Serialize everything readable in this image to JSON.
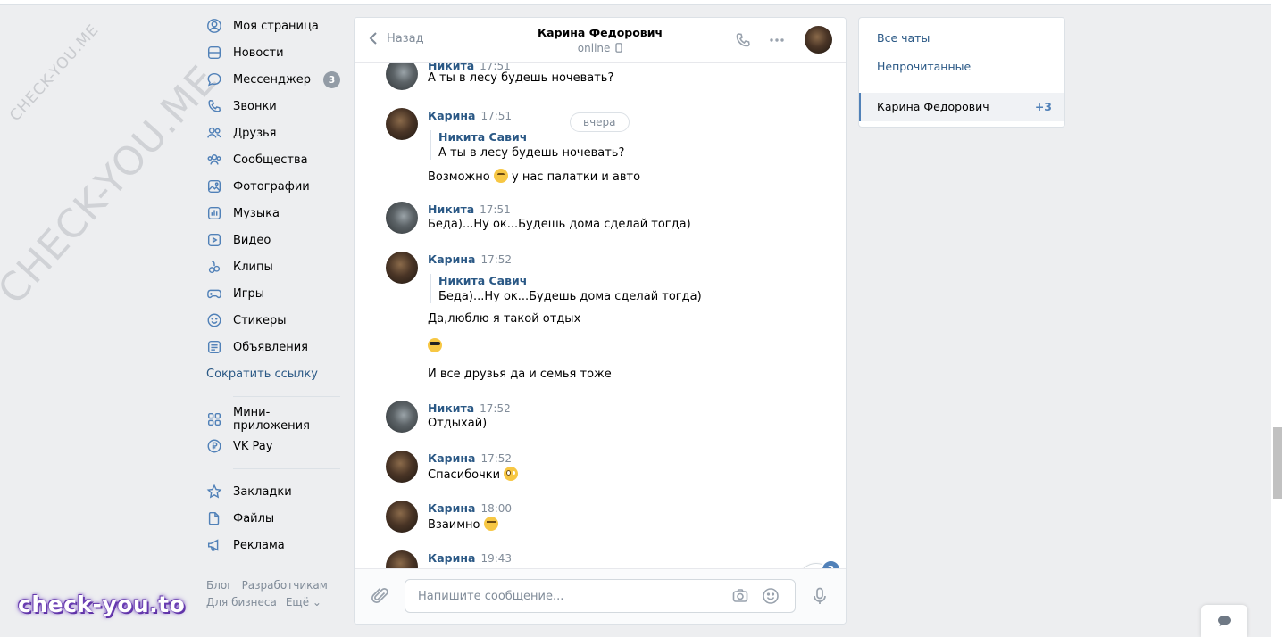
{
  "watermark": {
    "text": "CHECK-YOU.ME"
  },
  "logo": {
    "text": "check-you.to"
  },
  "nav": {
    "items": [
      {
        "label": "Моя страница",
        "icon": "user-circle-icon"
      },
      {
        "label": "Новости",
        "icon": "news-icon"
      },
      {
        "label": "Мессенджер",
        "icon": "chat-bubble-icon",
        "badge": "3"
      },
      {
        "label": "Звонки",
        "icon": "phone-icon"
      },
      {
        "label": "Друзья",
        "icon": "friends-icon"
      },
      {
        "label": "Сообщества",
        "icon": "communities-icon"
      },
      {
        "label": "Фотографии",
        "icon": "photo-icon"
      },
      {
        "label": "Музыка",
        "icon": "music-icon"
      },
      {
        "label": "Видео",
        "icon": "video-icon"
      },
      {
        "label": "Клипы",
        "icon": "clips-icon"
      },
      {
        "label": "Игры",
        "icon": "gamepad-icon"
      },
      {
        "label": "Стикеры",
        "icon": "smile-icon"
      },
      {
        "label": "Объявления",
        "icon": "classifieds-icon"
      }
    ],
    "shorten_link": "Сократить ссылку",
    "apps": [
      {
        "label": "Мини-приложения",
        "icon": "grid-icon"
      },
      {
        "label": "VK Pay",
        "icon": "ruble-icon"
      }
    ],
    "misc": [
      {
        "label": "Закладки",
        "icon": "star-icon"
      },
      {
        "label": "Файлы",
        "icon": "file-icon"
      },
      {
        "label": "Реклама",
        "icon": "megaphone-icon"
      }
    ],
    "footer": {
      "blog": "Блог",
      "dev": "Разработчикам",
      "business": "Для бизнеса",
      "more": "Ещё ⌄"
    }
  },
  "chat": {
    "back_label": "Назад",
    "peer_name": "Карина Федорович",
    "peer_status": "online",
    "date_pill": "вчера",
    "messages": [
      {
        "author": "Никита",
        "time": "17:51",
        "text": "А ты в лесу будешь ночевать?"
      },
      {
        "author": "Карина",
        "time": "17:51",
        "quote_author": "Никита Савич",
        "quote_text": "А ты в лесу будешь ночевать?",
        "text_before": "Возможно",
        "text_after": "у нас палатки и авто"
      },
      {
        "author": "Никита",
        "time": "17:51",
        "text": "Беда)...Ну ок...Будешь дома сделай тогда)"
      },
      {
        "author": "Карина",
        "time": "17:52",
        "quote_author": "Никита Савич",
        "quote_text": "Беда)...Ну ок...Будешь дома сделай тогда)",
        "text": "Да,люблю я такой отдых",
        "text2": "И все друзья да и семья тоже"
      },
      {
        "author": "Никита",
        "time": "17:52",
        "text": "Отдыхай)"
      },
      {
        "author": "Карина",
        "time": "17:52",
        "text": "Спасибочки"
      },
      {
        "author": "Карина",
        "time": "18:00",
        "text": "Взаимно"
      },
      {
        "author": "Карина",
        "time": "19:43"
      }
    ],
    "unread_badge": "3",
    "composer_placeholder": "Напишите сообщение..."
  },
  "right_panel": {
    "all_chats": "Все чаты",
    "unread": "Непрочитанные",
    "selected_name": "Карина Федорович",
    "selected_count": "+3"
  }
}
